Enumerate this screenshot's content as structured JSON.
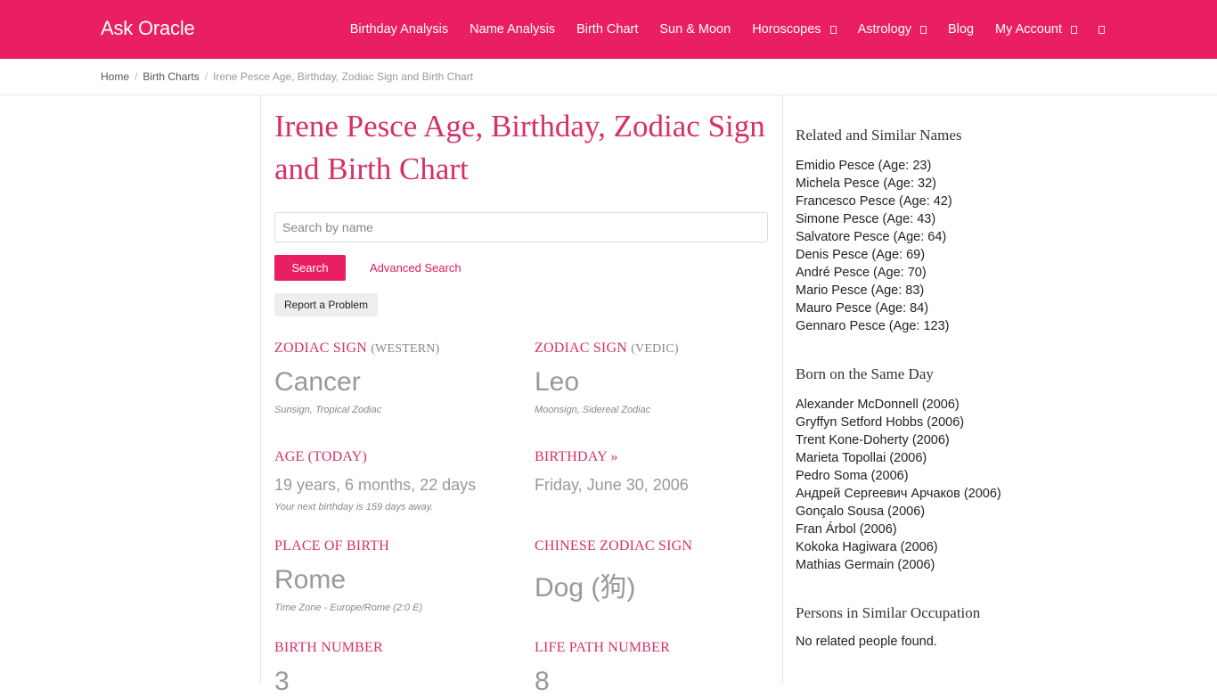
{
  "header": {
    "brand": "Ask Oracle",
    "nav": [
      {
        "label": "Birthday Analysis"
      },
      {
        "label": "Name Analysis"
      },
      {
        "label": "Birth Chart"
      },
      {
        "label": "Sun & Moon"
      },
      {
        "label": "Horoscopes"
      },
      {
        "label": "Astrology"
      },
      {
        "label": "Blog"
      },
      {
        "label": "My Account"
      }
    ]
  },
  "breadcrumb": {
    "home": "Home",
    "section": "Birth Charts",
    "current": "Irene Pesce Age, Birthday, Zodiac Sign and Birth Chart"
  },
  "main": {
    "title": "Irene Pesce Age, Birthday, Zodiac Sign and Birth Chart",
    "search": {
      "placeholder": "Search by name",
      "button": "Search",
      "advanced": "Advanced Search"
    },
    "report": "Report a Problem",
    "zodiac_western": {
      "label": "ZODIAC SIGN",
      "sub": "(WESTERN)",
      "value": "Cancer",
      "note": "Sunsign, Tropical Zodiac"
    },
    "zodiac_vedic": {
      "label": "ZODIAC SIGN",
      "sub": "(VEDIC)",
      "value": "Leo",
      "note": "Moonsign, Sidereal Zodiac"
    },
    "age": {
      "label": "AGE (TODAY)",
      "value": "19 years, 6 months, 22 days",
      "note": "Your next birthday is 159 days away."
    },
    "birthday": {
      "label": "BIRTHDAY »",
      "value": "Friday, June 30, 2006"
    },
    "place": {
      "label": "PLACE OF BIRTH",
      "value": "Rome",
      "note": "Time Zone - Europe/Rome (2:0 E)"
    },
    "chinese": {
      "label": "CHINESE ZODIAC SIGN",
      "value": "Dog (狗)"
    },
    "birth_number": {
      "label": "BIRTH NUMBER",
      "value": "3"
    },
    "life_path": {
      "label": "LIFE PATH NUMBER",
      "value": "8"
    }
  },
  "sidebar": {
    "related": {
      "title": "Related and Similar Names",
      "items": [
        "Emidio Pesce (Age: 23)",
        "Michela Pesce (Age: 32)",
        "Francesco Pesce (Age: 42)",
        "Simone Pesce (Age: 43)",
        "Salvatore Pesce (Age: 64)",
        "Denis Pesce (Age: 69)",
        "André Pesce (Age: 70)",
        "Mario Pesce (Age: 83)",
        "Mauro Pesce (Age: 84)",
        "Gennaro Pesce (Age: 123)"
      ]
    },
    "same_day": {
      "title": "Born on the Same Day",
      "items": [
        "Alexander McDonnell (2006)",
        "Gryffyn Setford Hobbs (2006)",
        "Trent Kone-Doherty (2006)",
        "Marieta Topollai (2006)",
        "Pedro Soma (2006)",
        "Андрей Сергеевич Арчаков (2006)",
        "Gonçalo Sousa (2006)",
        "Fran Árbol (2006)",
        "Kokoka Hagiwara (2006)",
        "Mathias Germain (2006)"
      ]
    },
    "occupation": {
      "title": "Persons in Similar Occupation",
      "empty": "No related people found."
    }
  }
}
